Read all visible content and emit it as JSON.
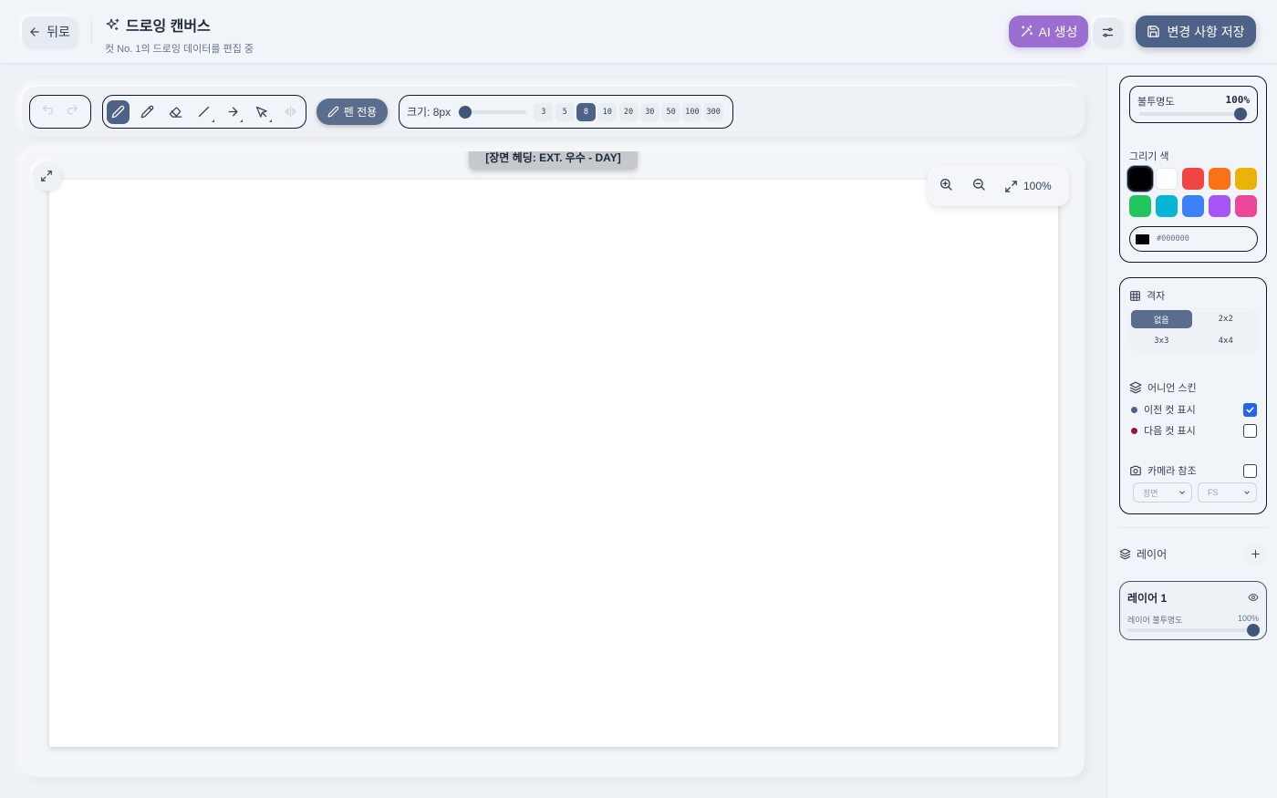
{
  "header": {
    "back_label": "뒤로",
    "title": "드로잉 캔버스",
    "subtitle": "컷 No. 1의 드로잉 데이터를 편집 중",
    "ai_label": "AI 생성",
    "save_label": "변경 사항 저장"
  },
  "toolbar": {
    "pen_only_label": "펜 전용",
    "size_label": "크기: 8px",
    "size_options": [
      "3",
      "5",
      "8",
      "10",
      "20",
      "30",
      "50",
      "100",
      "300"
    ],
    "selected_size": "8",
    "size_slider_fraction": 0.02
  },
  "canvas": {
    "scene_label": "[장면 헤딩: EXT. 우수 - DAY]",
    "zoom_label": "100%"
  },
  "sidebar": {
    "opacity_label": "불투명도",
    "opacity_value": "100%",
    "color_label": "그리기 색",
    "swatches": [
      "#000000",
      "#ffffff",
      "#ef4444",
      "#f97316",
      "#eab308",
      "#22c55e",
      "#06b6d4",
      "#3b82f6",
      "#a855f7",
      "#ec4899"
    ],
    "selected_color": "#000000",
    "hex_value": "#000000",
    "grid_label": "격자",
    "grid_options": [
      "없음",
      "2x2",
      "3x3",
      "4x4"
    ],
    "grid_selected": "없음",
    "onion_label": "어니언 스킨",
    "prev_cut_label": "이전 컷 표시",
    "prev_cut_checked": true,
    "next_cut_label": "다음 컷 표시",
    "next_cut_checked": false,
    "camera_label": "카메라 참조",
    "camera_checked": false,
    "camera_angle": "정면",
    "camera_shot": "FS",
    "layers_label": "레이어",
    "layer_name": "레이어 1",
    "layer_opacity_label": "레이어 불투명도",
    "layer_opacity_value": "100%"
  },
  "colors": {
    "accent": "#4d6286",
    "ai_purple": "#9b6fd1",
    "checkbox_blue": "#2563eb",
    "prev_dot": "#4d6286",
    "next_dot": "#9f1239"
  }
}
